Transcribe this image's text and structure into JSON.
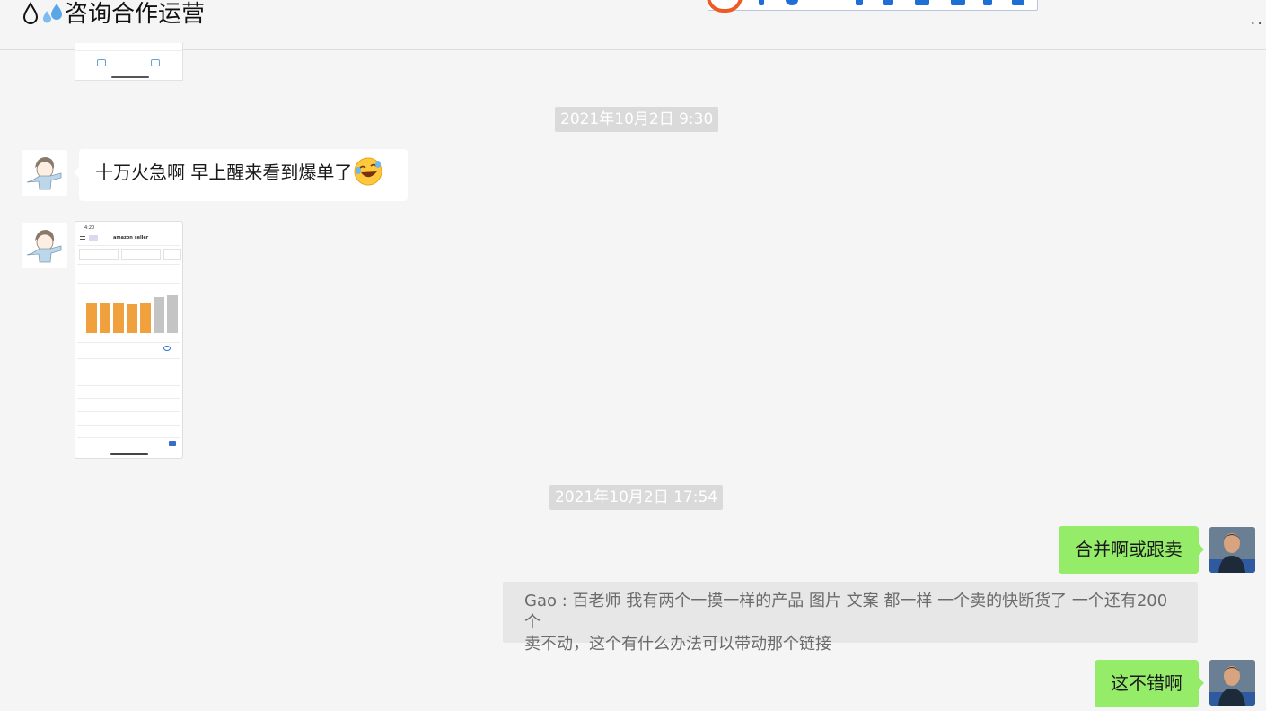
{
  "header": {
    "title": "咨询合作运营",
    "title_icons": [
      "droplet-icon",
      "sweat-droplets-icon"
    ],
    "more_label": "··"
  },
  "messages": {
    "timestamp_1": "2021年10月2日 9:30",
    "msg_1": "十万火急啊 早上醒来看到爆单了",
    "msg_1_emoji": "rolling-laughing-emoji",
    "timestamp_2": "2021年10月2日 17:54",
    "msg_2": "合并啊或跟卖",
    "quote_line1": "Gao : 百老师 我有两个一摸一样的产品 图片 文案 都一样 一个卖的快断货了 一个还有200个",
    "quote_line2": "卖不动，这个有什么办法可以带动那个链接",
    "msg_3": "这不错啊"
  },
  "screenshot": {
    "app_title": "amazon seller",
    "bar_values": [
      34,
      33,
      33,
      32,
      34,
      40,
      42
    ],
    "bar_colors": [
      "#f0a03c",
      "#f0a03c",
      "#f0a03c",
      "#f0a03c",
      "#f0a03c",
      "#c4c4c4",
      "#c4c4c4"
    ]
  },
  "colors": {
    "accent_green": "#95ec69",
    "timestamp_bg": "#dadada",
    "quote_bg": "#e7e7e7"
  }
}
